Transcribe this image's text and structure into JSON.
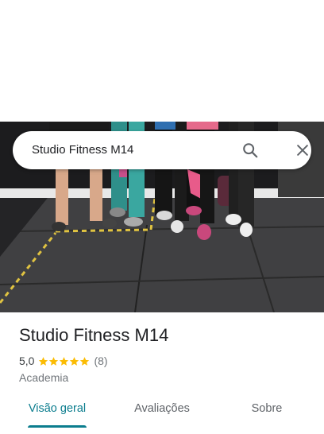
{
  "search": {
    "query": "Studio Fitness M14",
    "search_icon": "search-icon",
    "close_icon": "close-icon"
  },
  "place": {
    "title": "Studio Fitness M14",
    "rating": "5,0",
    "stars": 5,
    "review_count": "(8)",
    "category": "Academia"
  },
  "tabs": [
    {
      "label": "Visão geral",
      "active": true
    },
    {
      "label": "Avaliações",
      "active": false
    },
    {
      "label": "Sobre",
      "active": false
    }
  ],
  "colors": {
    "accent": "#0b7d8e",
    "star": "#fbbc04",
    "text_primary": "#202124",
    "text_secondary": "#70757a"
  }
}
